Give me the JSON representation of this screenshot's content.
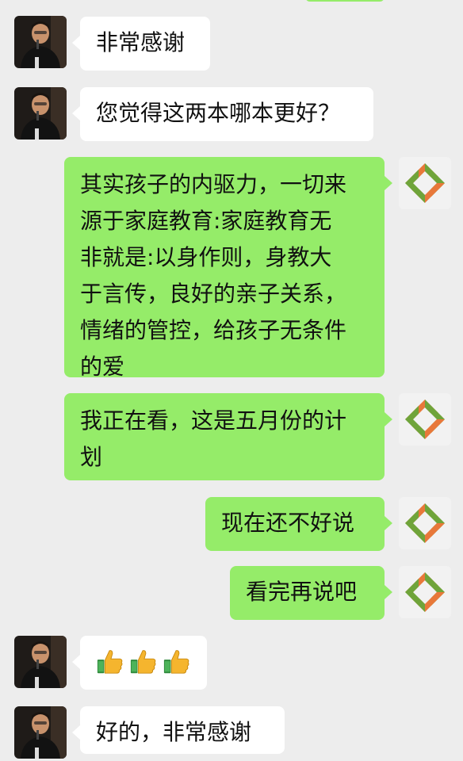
{
  "colors": {
    "background": "#ededed",
    "incoming_bubble": "#ffffff",
    "outgoing_bubble": "#95ec69",
    "logo_orange": "#e8783a",
    "logo_green": "#6fa43a"
  },
  "messages": [
    {
      "sender": "contact",
      "avatar": "person-photo",
      "text": "非常感谢"
    },
    {
      "sender": "contact",
      "avatar": "person-photo",
      "text": "您觉得这两本哪本更好？"
    },
    {
      "sender": "self",
      "avatar": "diamond-logo",
      "lines": [
        "其实孩子的内驱力，一切来",
        "源于家庭教育:家庭教育无",
        "非就是:以身作则，身教大",
        "于言传，良好的亲子关系，",
        "情绪的管控，给孩子无条件",
        "的爱"
      ]
    },
    {
      "sender": "self",
      "avatar": "diamond-logo",
      "lines": [
        "我正在看，这是五月份的计",
        "划"
      ]
    },
    {
      "sender": "self",
      "avatar": "diamond-logo",
      "text": "现在还不好说"
    },
    {
      "sender": "self",
      "avatar": "diamond-logo",
      "text": "看完再说吧"
    },
    {
      "sender": "contact",
      "avatar": "person-photo",
      "emoji": [
        "thumbs-up-icon",
        "thumbs-up-icon",
        "thumbs-up-icon"
      ]
    },
    {
      "sender": "contact",
      "avatar": "person-photo",
      "text": "好的，非常感谢"
    }
  ]
}
